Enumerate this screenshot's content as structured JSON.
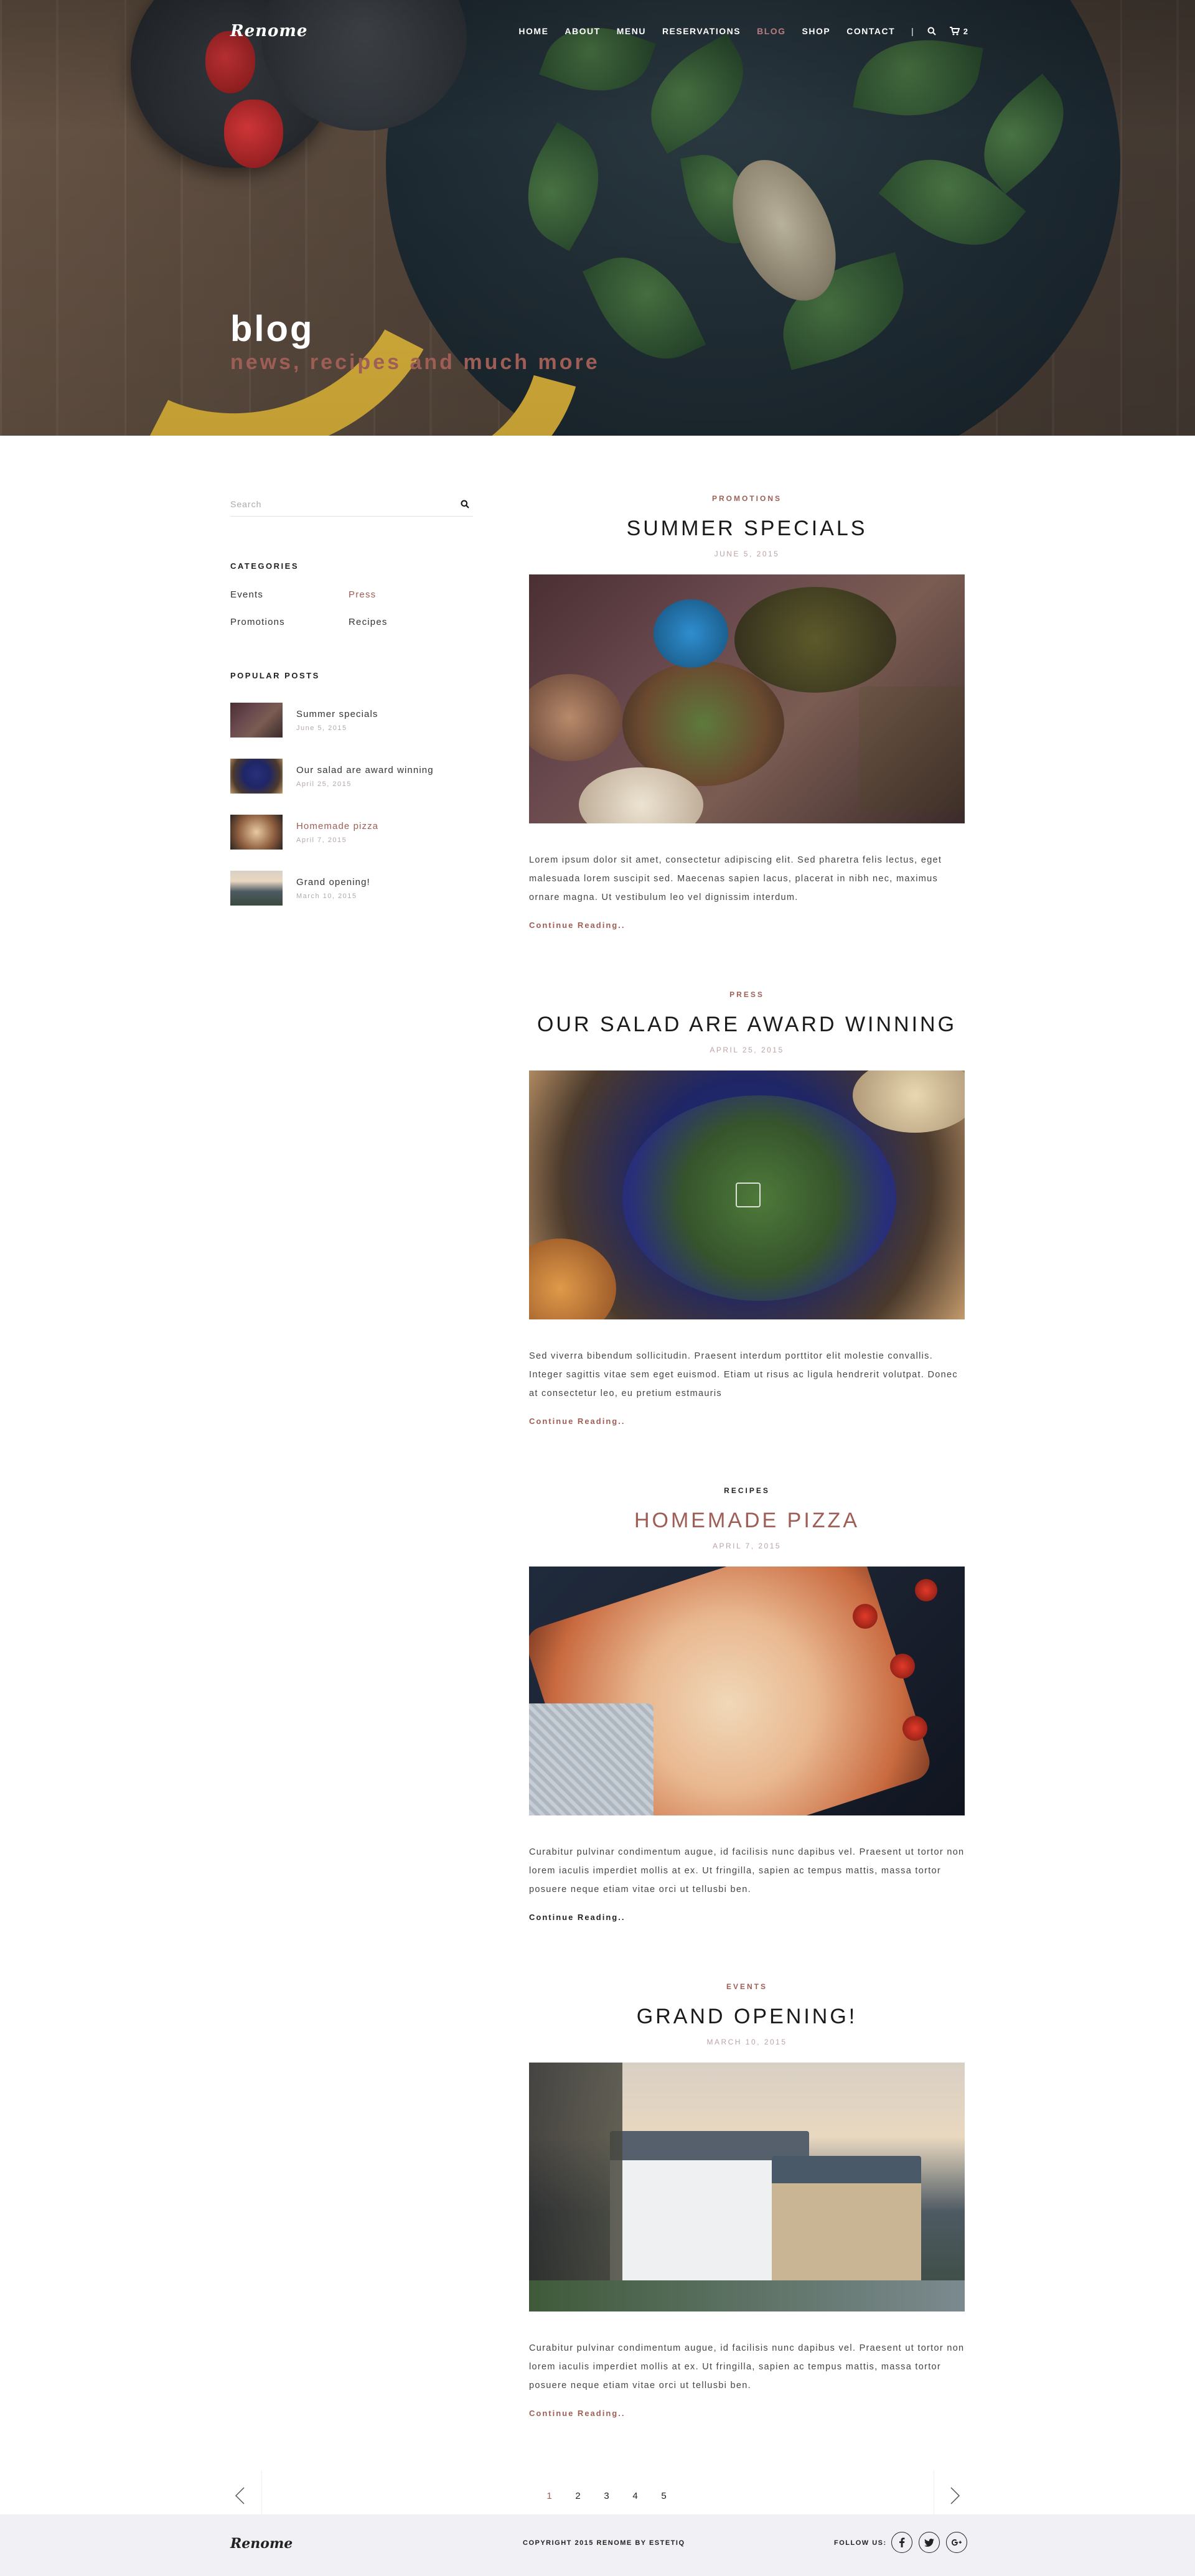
{
  "brand": {
    "logo": "Renome"
  },
  "nav": {
    "items": [
      {
        "label": "HOME",
        "active": false
      },
      {
        "label": "ABOUT",
        "active": false
      },
      {
        "label": "MENU",
        "active": false
      },
      {
        "label": "RESERVATIONS",
        "active": false
      },
      {
        "label": "BLOG",
        "active": true
      },
      {
        "label": "SHOP",
        "active": false
      },
      {
        "label": "CONTACT",
        "active": false
      }
    ],
    "separator": "|",
    "search_icon": "search-icon",
    "cart_icon": "cart-icon",
    "cart_count": "2"
  },
  "hero": {
    "title": "blog",
    "subtitle": "news, recipes and much more"
  },
  "sidebar": {
    "search_placeholder": "Search",
    "categories_heading": "CATEGORIES",
    "categories": [
      {
        "label": "Events",
        "active": false
      },
      {
        "label": "Press",
        "active": true
      },
      {
        "label": "Promotions",
        "active": false
      },
      {
        "label": "Recipes",
        "active": false
      }
    ],
    "popular_heading": "POPULAR POSTS",
    "popular_posts": [
      {
        "title": "Summer specials",
        "date": "June 5, 2015",
        "active": false
      },
      {
        "title": "Our salad are award winning",
        "date": "April 25, 2015",
        "active": false
      },
      {
        "title": "Homemade pizza",
        "date": "April 7, 2015",
        "active": true
      },
      {
        "title": "Grand opening!",
        "date": "March 10, 2015",
        "active": false
      }
    ]
  },
  "posts": [
    {
      "category": "PROMOTIONS",
      "title": "SUMMER SPECIALS",
      "date": "JUNE 5, 2015",
      "body": "Lorem ipsum dolor sit amet, consectetur adipiscing elit. Sed pharetra felis lectus, eget malesuada lorem suscipit sed. Maecenas sapien lacus, placerat in nibh nec, maximus ornare magna. Ut vestibulum leo vel dignissim interdum.",
      "more": "Continue Reading..",
      "highlight": false
    },
    {
      "category": "PRESS",
      "title": "OUR SALAD ARE AWARD WINNING",
      "date": "APRIL 25, 2015",
      "body": "Sed viverra bibendum sollicitudin. Praesent interdum porttitor elit molestie convallis. Integer sagittis vitae sem eget euismod. Etiam ut risus ac ligula hendrerit volutpat. Donec at consectetur leo, eu pretium estmauris",
      "more": "Continue Reading..",
      "highlight": false
    },
    {
      "category": "RECIPES",
      "title": "HOMEMADE PIZZA",
      "date": "APRIL 7, 2015",
      "body": "Curabitur pulvinar condimentum augue, id facilisis nunc dapibus vel. Praesent ut tortor non lorem iaculis imperdiet mollis at ex. Ut fringilla, sapien ac tempus mattis, massa tortor posuere neque  etiam vitae orci ut tellusbi ben.",
      "more": "Continue Reading..",
      "highlight": true
    },
    {
      "category": "EVENTS",
      "title": "GRAND OPENING!",
      "date": "MARCH 10, 2015",
      "body": "Curabitur pulvinar condimentum augue, id facilisis nunc dapibus vel. Praesent ut tortor non lorem iaculis imperdiet mollis at ex. Ut fringilla, sapien ac tempus mattis, massa tortor posuere neque  etiam vitae orci ut tellusbi ben.",
      "more": "Continue Reading..",
      "highlight": false
    }
  ],
  "pagination": {
    "pages": [
      "1",
      "2",
      "3",
      "4",
      "5"
    ],
    "active_page": "1",
    "prev_icon": "chevron-left-icon",
    "next_icon": "chevron-right-icon"
  },
  "footer": {
    "logo": "Renome",
    "copyright": "COPYRIGHT 2015 RENOME BY ESTETIQ",
    "follow_label": "FOLLOW US:",
    "social": [
      "facebook-icon",
      "twitter-icon",
      "google-plus-icon"
    ]
  },
  "colors": {
    "accent": "#9e5e55",
    "nav_active": "#b77c83",
    "footer_bg": "#f1f0f4"
  }
}
